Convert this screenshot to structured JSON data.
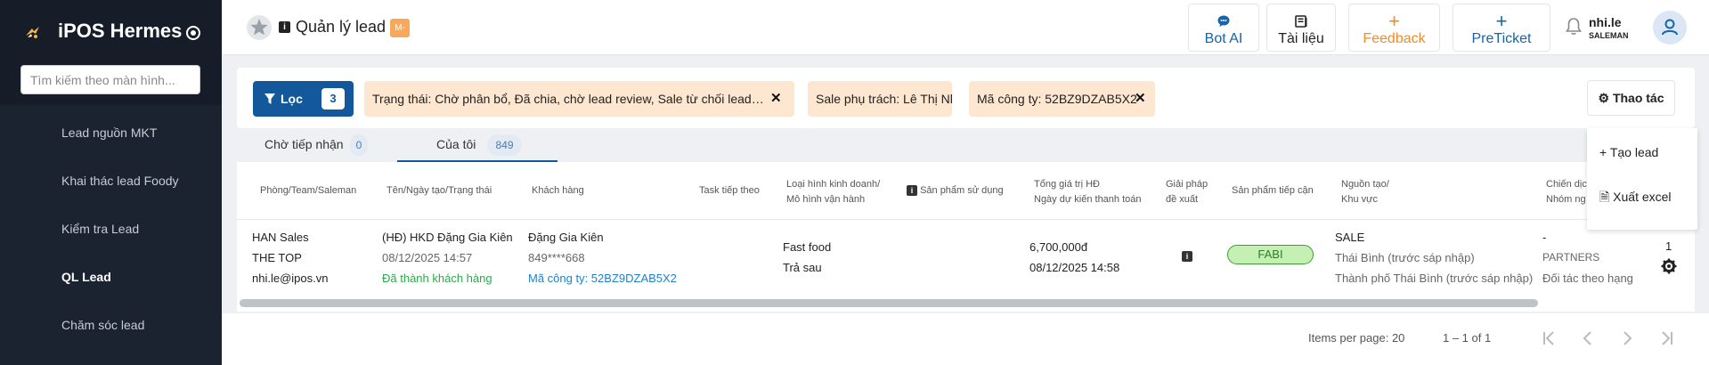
{
  "app": {
    "brand": "iPOS Hermes",
    "search_placeholder": "Tìm kiếm theo màn hình..."
  },
  "sidebar": {
    "items": [
      {
        "label": "Lead nguồn MKT",
        "active": false
      },
      {
        "label": "Khai thác lead Foody",
        "active": false
      },
      {
        "label": "Kiểm tra Lead",
        "active": false
      },
      {
        "label": "QL Lead",
        "active": true
      },
      {
        "label": "Chăm sóc lead",
        "active": false
      }
    ]
  },
  "header": {
    "page_title": "Quản lý lead",
    "badge": "M-",
    "buttons": {
      "bot": "Bot AI",
      "docs": "Tài liệu",
      "feedback": "Feedback",
      "preticket": "PreTicket"
    },
    "user": {
      "name": "nhi.le",
      "role": "SALEMAN"
    }
  },
  "filters": {
    "button_label": "Lọc",
    "count": "3",
    "chips": {
      "status": "Trạng thái: Chờ phân bổ, Đã chia, chờ lead review, Sale từ chối lead, Mới...",
      "sale": "Sale phụ trách: Lê Thị Nhi",
      "company": "Mã công ty: 52BZ9DZAB5X2"
    },
    "action_button": "Thao tác",
    "action_menu": [
      "Tạo lead",
      "Xuất excel"
    ]
  },
  "tabs": [
    {
      "label": "Chờ tiếp nhận",
      "count": "0"
    },
    {
      "label": "Của tôi",
      "count": "849"
    }
  ],
  "table": {
    "headers": {
      "team": "Phòng/Team/Saleman",
      "name": "Tên/Ngày tạo/Trạng thái",
      "customer": "Khách hàng",
      "task": "Task tiếp theo",
      "business_1": "Loại hình kinh doanh/",
      "business_2": "Mô hình vận hành",
      "product": "Sản phẩm sử dụng",
      "value_1": "Tổng giá trị HĐ",
      "value_2": "Ngày dự kiến thanh toán",
      "solution_1": "Giải pháp",
      "solution_2": "đề xuất",
      "approach": "Sản phẩm tiếp cận",
      "source_1": "Nguồn tạo/",
      "source_2": "Khu vực",
      "campaign_1": "Chiến dịch",
      "campaign_2": "Nhóm ng"
    },
    "row": {
      "team": "HAN Sales",
      "sub_team": "THE TOP",
      "saleman": "nhi.le@ipos.vn",
      "lead_name": "(HĐ) HKD Đặng Gia Kiên",
      "created": "08/12/2025  14:57",
      "status": "Đã thành khách hàng",
      "customer": "Đặng Gia Kiên",
      "phone": "849****668",
      "company_code": "Mã công ty: 52BZ9DZAB5X2",
      "business_type": "Fast food",
      "operation": "Trả sau",
      "contract_value": "6,700,000đ",
      "payment_date": "08/12/2025 14:58",
      "approach_product": "FABI",
      "source": "SALE",
      "area_1": "Thái Bình (trước sáp nhập)",
      "area_2": "Thành phố Thái Bình (trước sáp nhập)",
      "campaign": "-",
      "group": "PARTNERS",
      "partner": "Đối tác theo hạng",
      "index": "1"
    }
  },
  "pagination": {
    "items_per_page": "Items per page: 20",
    "range": "1 – 1 of 1"
  },
  "colors": {
    "sidebar": "#1b2331",
    "primary": "#13589b",
    "chip": "#fde7d0",
    "feedback": "#f08c28",
    "success": "#2fa84f"
  }
}
